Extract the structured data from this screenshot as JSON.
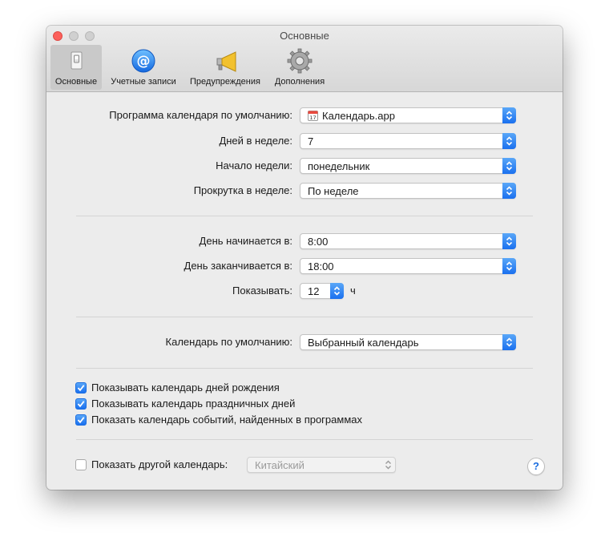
{
  "window": {
    "title": "Основные"
  },
  "toolbar": {
    "tabs": [
      {
        "label": "Основные",
        "icon": "switch-icon",
        "active": true
      },
      {
        "label": "Учетные записи",
        "icon": "at-sign-icon",
        "active": false
      },
      {
        "label": "Предупреждения",
        "icon": "megaphone-icon",
        "active": false
      },
      {
        "label": "Дополнения",
        "icon": "gear-icon",
        "active": false
      }
    ]
  },
  "general": {
    "default_calendar_app": {
      "label": "Программа календаря по умолчанию:",
      "value": "Календарь.app",
      "icon": "calendar-app-icon"
    },
    "days_per_week": {
      "label": "Дней в неделе:",
      "value": "7"
    },
    "week_start": {
      "label": "Начало недели:",
      "value": "понедельник"
    },
    "scroll_in_week": {
      "label": "Прокрутка в неделе:",
      "value": "По неделе"
    }
  },
  "day_hours": {
    "day_starts": {
      "label": "День начинается в:",
      "value": "8:00"
    },
    "day_ends": {
      "label": "День заканчивается в:",
      "value": "18:00"
    },
    "show": {
      "label": "Показывать:",
      "value": "12",
      "unit": "ч"
    }
  },
  "default_calendar": {
    "label": "Календарь по умолчанию:",
    "value": "Выбранный календарь"
  },
  "checkboxes": [
    {
      "label": "Показывать календарь дней рождения",
      "checked": true
    },
    {
      "label": "Показывать календарь праздничных дней",
      "checked": true
    },
    {
      "label": "Показать календарь событий, найденных в программах",
      "checked": true
    }
  ],
  "alt_calendar": {
    "label": "Показать другой календарь:",
    "checked": false,
    "value": "Китайский",
    "enabled": false
  },
  "help": {
    "label": "?"
  },
  "colors": {
    "accent": "#1a70ef",
    "window_bg": "#ececec",
    "close_button": "#fc605b"
  }
}
